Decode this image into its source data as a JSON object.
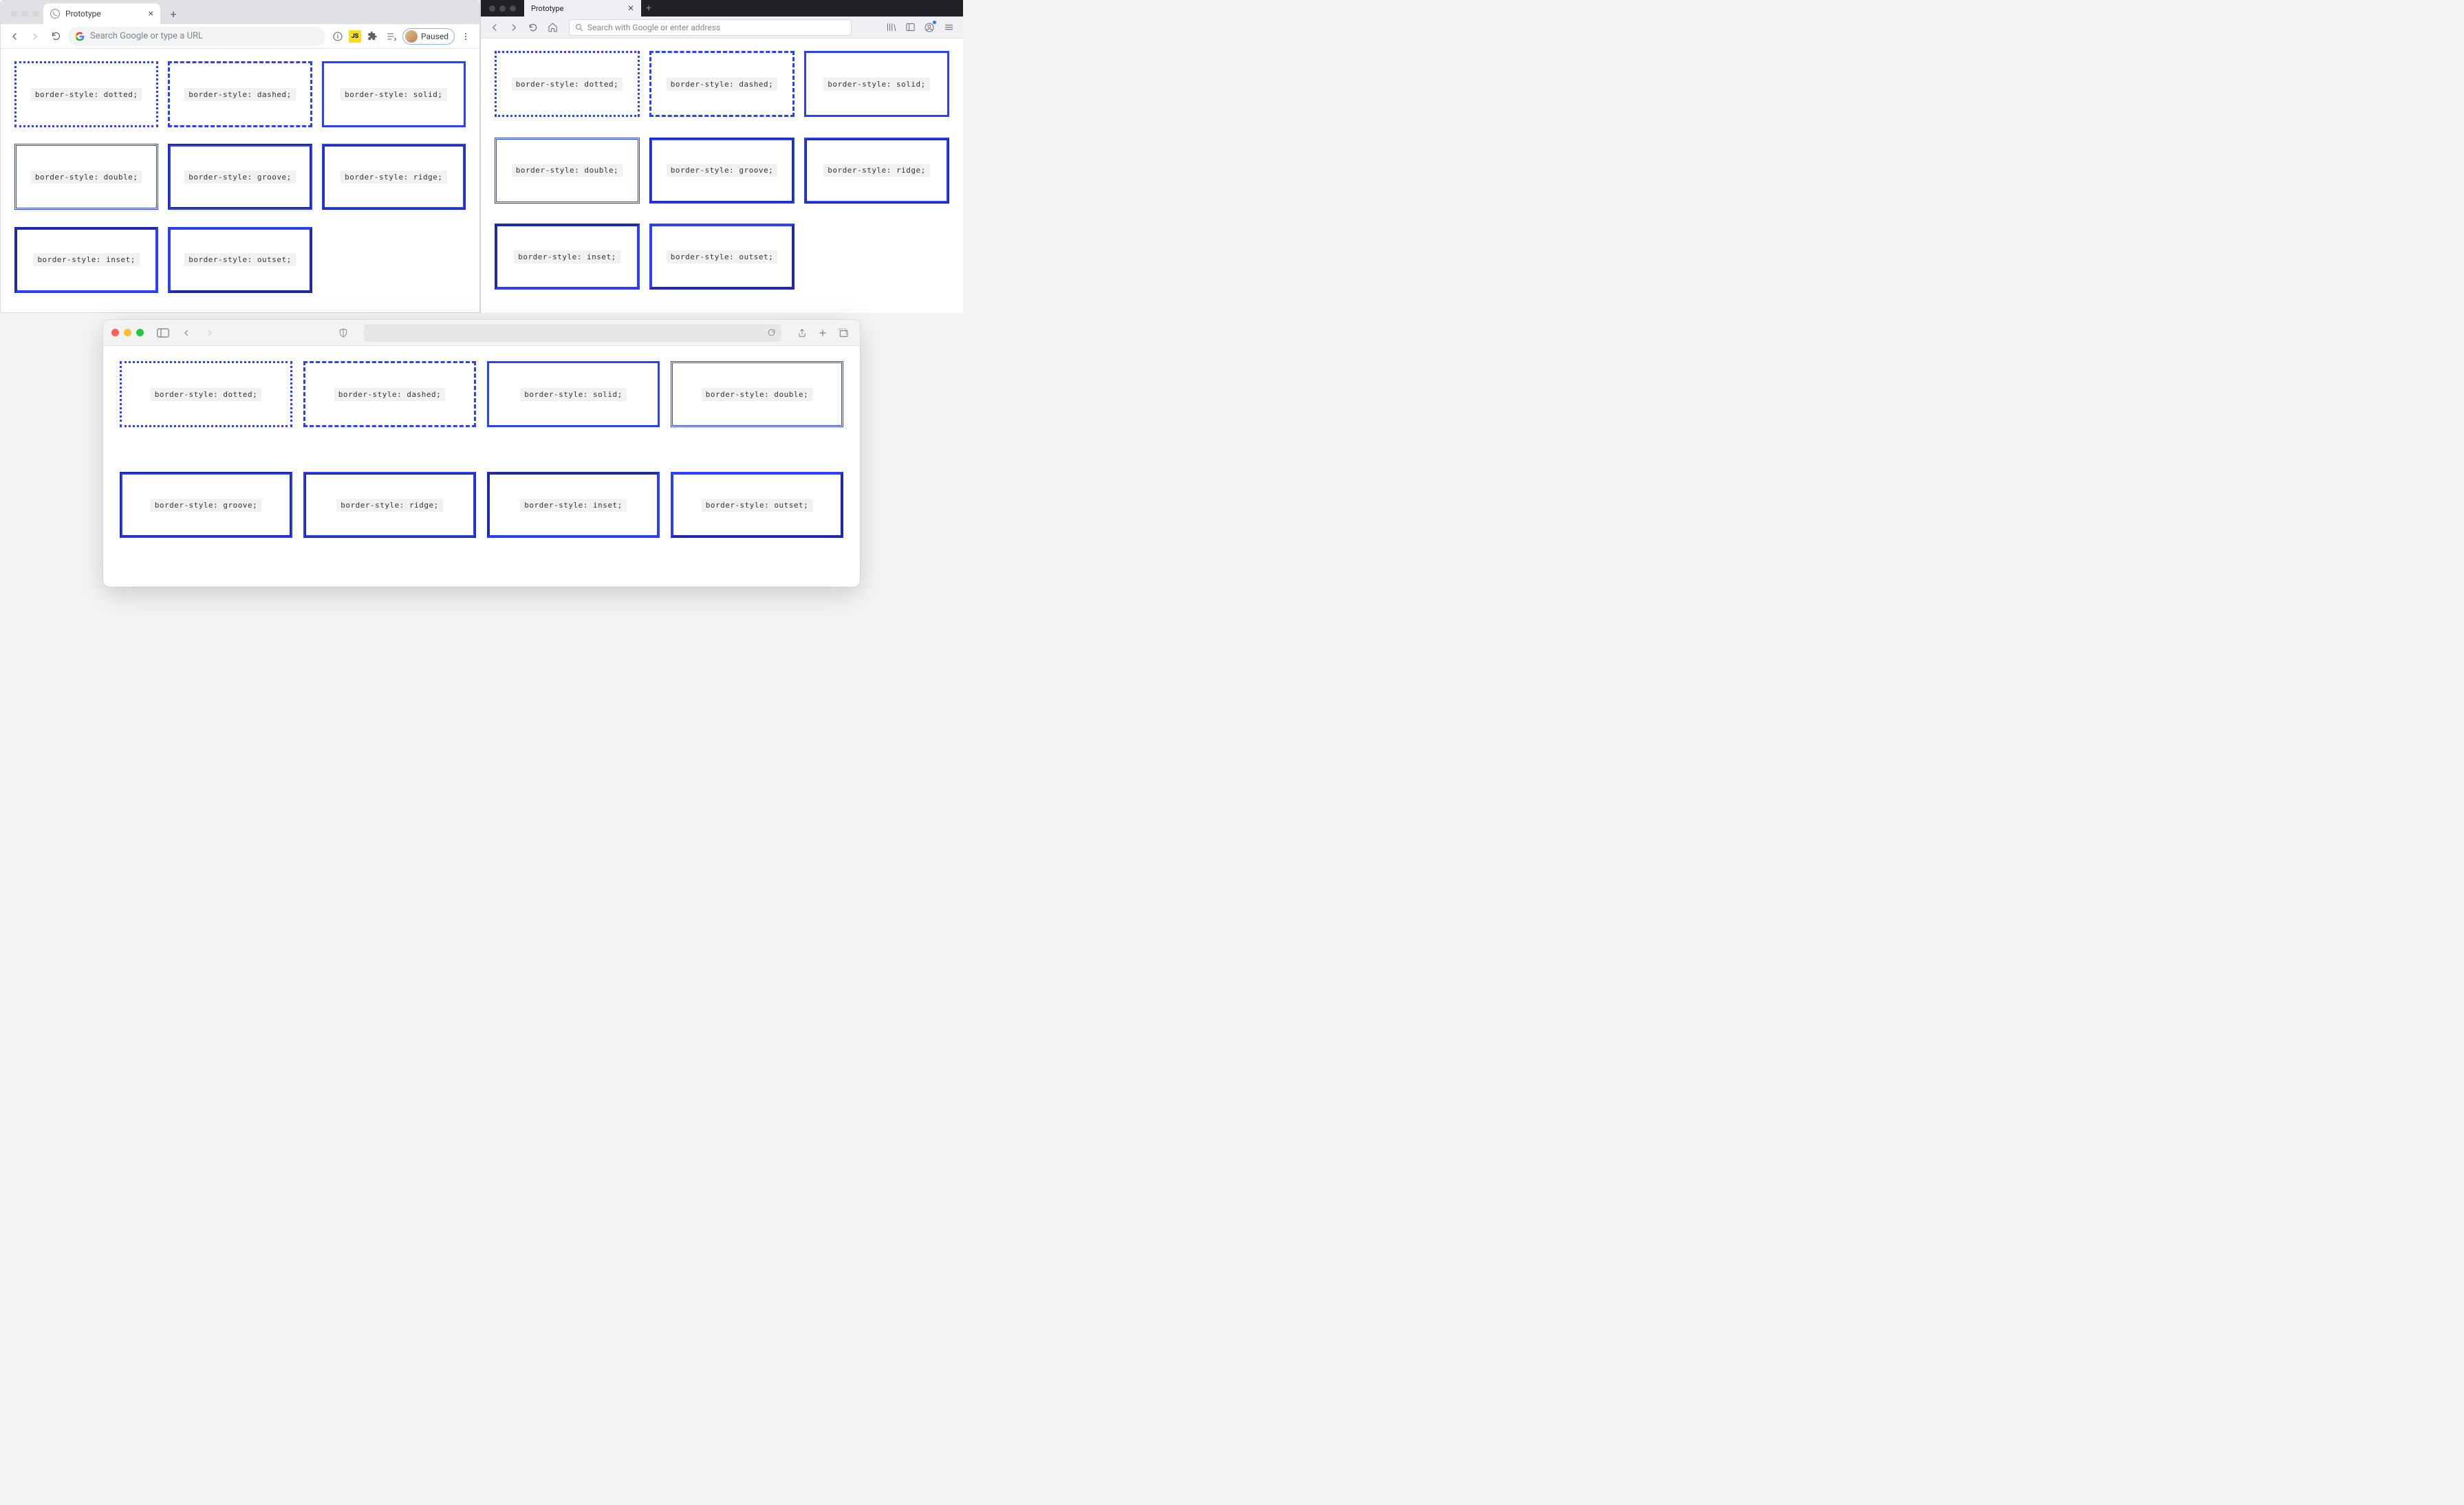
{
  "chrome": {
    "tab_title": "Prototype",
    "omnibox_placeholder": "Search Google or type a URL",
    "paused_label": "Paused"
  },
  "firefox": {
    "tab_title": "Prototype",
    "urlbar_placeholder": "Search with Google or enter address"
  },
  "safari": {},
  "border_labels": {
    "dotted": "border-style: dotted;",
    "dashed": "border-style: dashed;",
    "solid": "border-style: solid;",
    "double": "border-style: double;",
    "groove": "border-style: groove;",
    "ridge": "border-style: ridge;",
    "inset": "border-style: inset;",
    "outset": "border-style: outset;"
  },
  "layouts": {
    "chrome": [
      "dotted",
      "dashed",
      "solid",
      "double",
      "groove",
      "ridge",
      "inset",
      "outset"
    ],
    "firefox": [
      "dotted",
      "dashed",
      "solid",
      "double",
      "groove",
      "ridge",
      "inset",
      "outset"
    ],
    "safari": [
      "dotted",
      "dashed",
      "solid",
      "double",
      "groove",
      "ridge",
      "inset",
      "outset"
    ]
  },
  "colors": {
    "border_blue": "#2a3fff"
  }
}
